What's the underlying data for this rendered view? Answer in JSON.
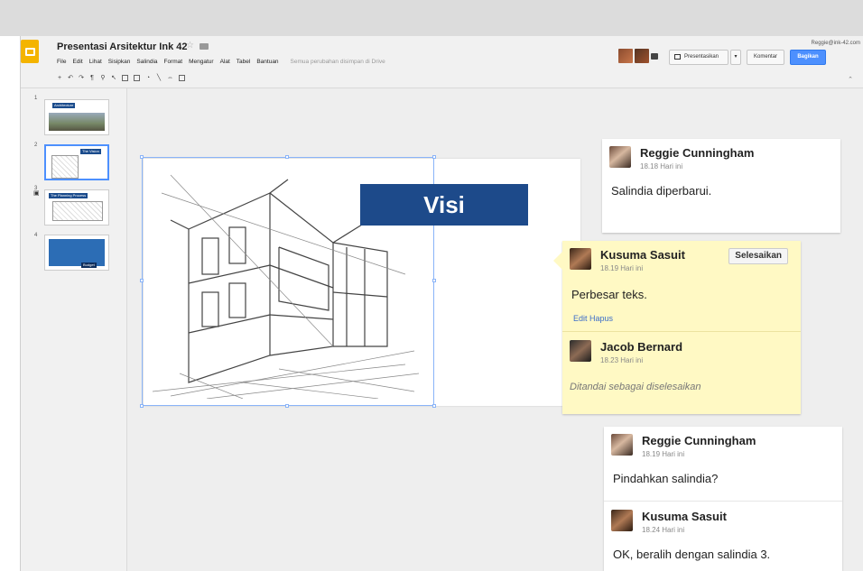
{
  "app": {
    "doc_title": "Presentasi Arsitektur Ink 42",
    "user_email": "Reggie@ink-42.com",
    "menu": [
      "File",
      "Edit",
      "Lihat",
      "Sisipkan",
      "Salindia",
      "Format",
      "Mengatur",
      "Alat",
      "Tabel",
      "Bantuan"
    ],
    "save_status": "Semua perubahan disimpan di Drive"
  },
  "buttons": {
    "present": "Presentasikan",
    "dropdown": "▾",
    "comments": "Komentar",
    "share": "Bagikan"
  },
  "toolbar_icons": [
    "plus-icon",
    "undo-icon",
    "redo-icon",
    "paint-format-icon",
    "zoom-icon",
    "select-icon",
    "text-box-icon",
    "image-icon",
    "shape-icon",
    "line-icon",
    "link-icon",
    "comment-add-icon"
  ],
  "thumbnails": [
    {
      "num": "1",
      "caption": "Architecture"
    },
    {
      "num": "2",
      "caption": "The Vision"
    },
    {
      "num": "3",
      "caption": "The Planning Process"
    },
    {
      "num": "4",
      "caption": "Budget"
    }
  ],
  "slide": {
    "heading": "Visi"
  },
  "comments": {
    "c1": {
      "author": "Reggie Cunningham",
      "time": "18.18 Hari ini",
      "text": "Salindia diperbarui."
    },
    "c2": {
      "author": "Kusuma Sasuit",
      "time": "18.19 Hari ini",
      "text": "Perbesar teks.",
      "links": "Edit Hapus",
      "resolve": "Selesaikan"
    },
    "c2_reply": {
      "author": "Jacob Bernard",
      "time": "18.23 Hari ini",
      "text": "Ditandai sebagai diselesaikan"
    },
    "c3": {
      "author": "Reggie Cunningham",
      "time": "18.19 Hari ini",
      "text": "Pindahkan salindia?"
    },
    "c3_reply": {
      "author": "Kusuma Sasuit",
      "time": "18.24 Hari ini",
      "text": "OK, beralih dengan salindia 3."
    }
  },
  "colors": {
    "accent": "#4d90fe",
    "slide_heading_bg": "#1d4a8a",
    "resolved_comment_bg": "#fff9c4",
    "logo": "#f4b400"
  }
}
